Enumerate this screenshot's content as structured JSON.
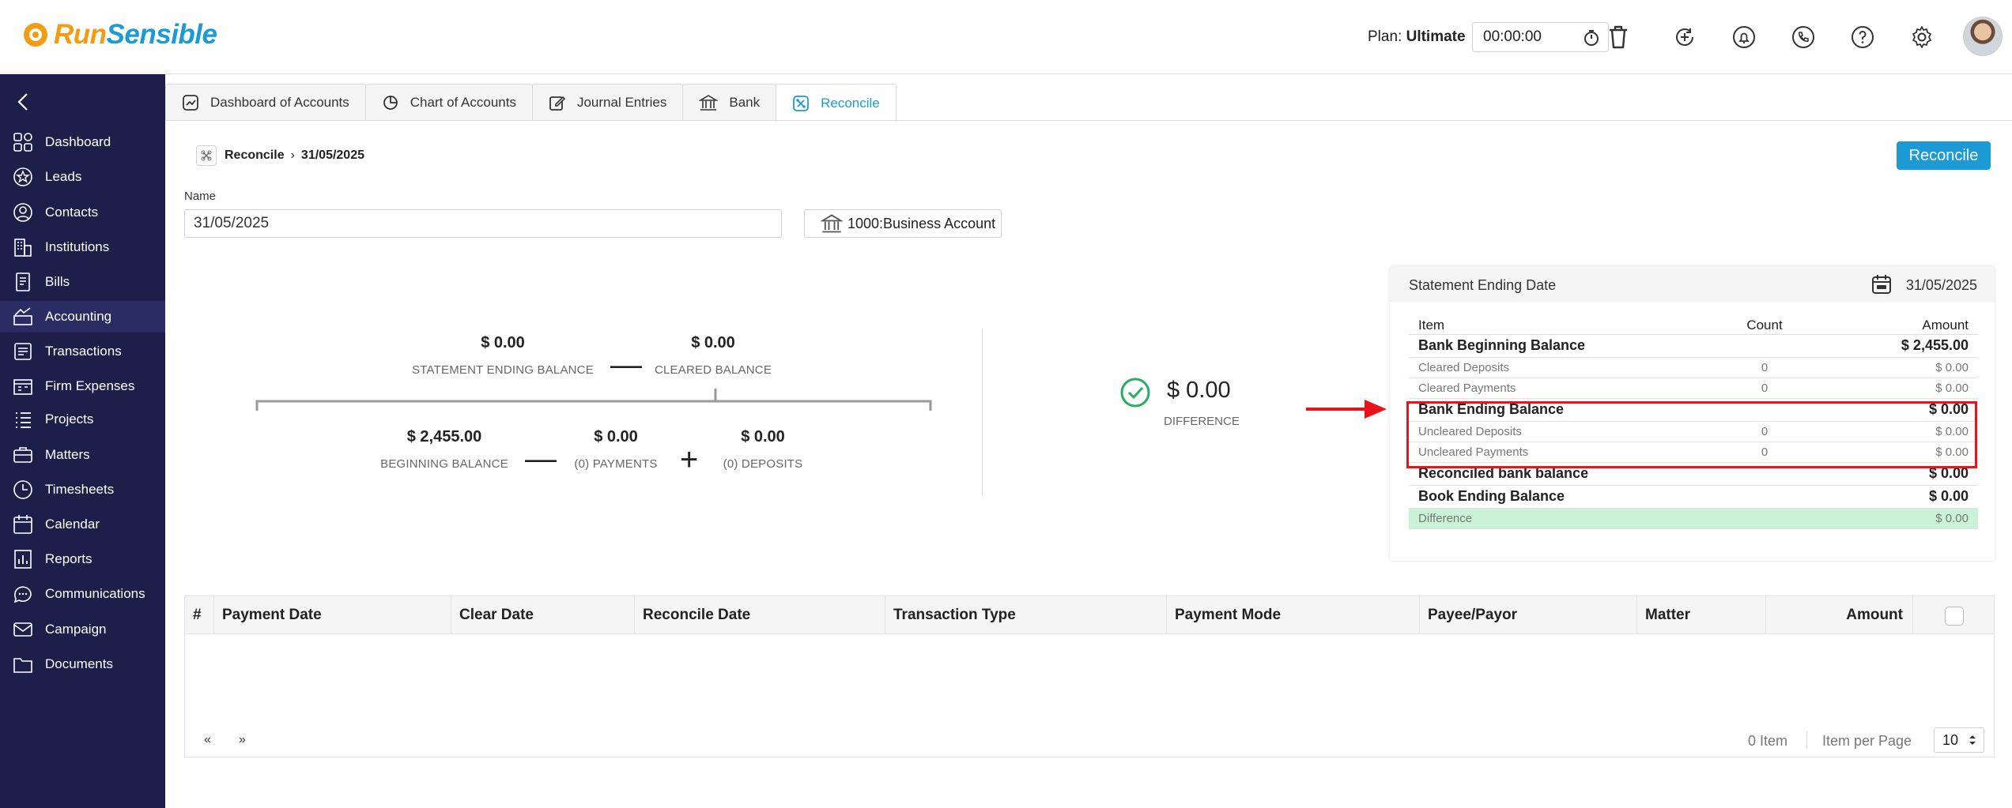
{
  "header": {
    "logo_run": "Run",
    "logo_sensible": "Sensible",
    "plan_label": "Plan:",
    "plan_value": "Ultimate",
    "timer": "00:00:00"
  },
  "sidebar": {
    "items": [
      {
        "label": "Dashboard",
        "icon": "dashboard-icon"
      },
      {
        "label": "Leads",
        "icon": "star-icon"
      },
      {
        "label": "Contacts",
        "icon": "user-circle-icon"
      },
      {
        "label": "Institutions",
        "icon": "building-icon"
      },
      {
        "label": "Bills",
        "icon": "bill-icon"
      },
      {
        "label": "Accounting",
        "icon": "accounting-icon"
      },
      {
        "label": "Transactions",
        "icon": "transactions-icon"
      },
      {
        "label": "Firm Expenses",
        "icon": "expenses-icon"
      },
      {
        "label": "Projects",
        "icon": "list-icon"
      },
      {
        "label": "Matters",
        "icon": "briefcase-icon"
      },
      {
        "label": "Timesheets",
        "icon": "clock-icon"
      },
      {
        "label": "Calendar",
        "icon": "calendar-icon"
      },
      {
        "label": "Reports",
        "icon": "reports-icon"
      },
      {
        "label": "Communications",
        "icon": "chat-icon"
      },
      {
        "label": "Campaign",
        "icon": "mail-icon"
      },
      {
        "label": "Documents",
        "icon": "folder-icon"
      }
    ],
    "active": "Accounting"
  },
  "tabs": [
    {
      "label": "Dashboard of Accounts",
      "icon": "chart-icon"
    },
    {
      "label": "Chart of Accounts",
      "icon": "pie-icon"
    },
    {
      "label": "Journal Entries",
      "icon": "edit-icon"
    },
    {
      "label": "Bank",
      "icon": "bank-icon"
    },
    {
      "label": "Reconcile",
      "icon": "reconcile-icon"
    }
  ],
  "breadcrumb": {
    "root": "Reconcile",
    "current": "31/05/2025"
  },
  "reconcile_button": "Reconcile",
  "form": {
    "name_label": "Name",
    "name_value": "31/05/2025",
    "account": "1000:Business Account"
  },
  "summary": {
    "statement_ending_balance": "$ 0.00",
    "statement_ending_label": "STATEMENT ENDING BALANCE",
    "cleared_balance": "$ 0.00",
    "cleared_label": "CLEARED BALANCE",
    "beginning_balance": "$ 2,455.00",
    "beginning_label": "BEGINNING BALANCE",
    "payments": "$ 0.00",
    "payments_label": "(0) PAYMENTS",
    "deposits": "$ 0.00",
    "deposits_label": "(0) DEPOSITS",
    "minus": "—",
    "plus": "+",
    "difference": "$ 0.00",
    "difference_label": "DIFFERENCE"
  },
  "statement": {
    "title": "Statement Ending Date",
    "date": "31/05/2025",
    "headers": {
      "item": "Item",
      "count": "Count",
      "amount": "Amount"
    },
    "rows": [
      {
        "item": "Bank Beginning Balance",
        "count": "",
        "amount": "$ 2,455.00",
        "kind": "main"
      },
      {
        "item": "Cleared Deposits",
        "count": "0",
        "amount": "$ 0.00",
        "kind": "sub"
      },
      {
        "item": "Cleared Payments",
        "count": "0",
        "amount": "$ 0.00",
        "kind": "sub"
      },
      {
        "item": "Bank Ending Balance",
        "count": "",
        "amount": "$ 0.00",
        "kind": "main"
      },
      {
        "item": "Uncleared Deposits",
        "count": "0",
        "amount": "$ 0.00",
        "kind": "sub"
      },
      {
        "item": "Uncleared Payments",
        "count": "0",
        "amount": "$ 0.00",
        "kind": "sub"
      },
      {
        "item": "Reconciled bank balance",
        "count": "",
        "amount": "$ 0.00",
        "kind": "main"
      },
      {
        "item": "Book Ending Balance",
        "count": "",
        "amount": "$ 0.00",
        "kind": "main"
      },
      {
        "item": "Difference",
        "count": "",
        "amount": "$ 0.00",
        "kind": "diff"
      }
    ]
  },
  "transactions": {
    "columns": [
      "#",
      "Payment Date",
      "Clear Date",
      "Reconcile Date",
      "Transaction Type",
      "Payment Mode",
      "Payee/Payor",
      "Matter",
      "Amount"
    ],
    "pager_prev": "«",
    "pager_next": "»",
    "items": "0 Item",
    "items_per_page_label": "Item per Page",
    "items_per_page": "10"
  },
  "colors": {
    "accent": "#1b9ad6",
    "sidebar": "#1d1f4b",
    "highlight": "#e8141b",
    "success": "#27ae60",
    "difference_row": "#c9f2d6"
  }
}
